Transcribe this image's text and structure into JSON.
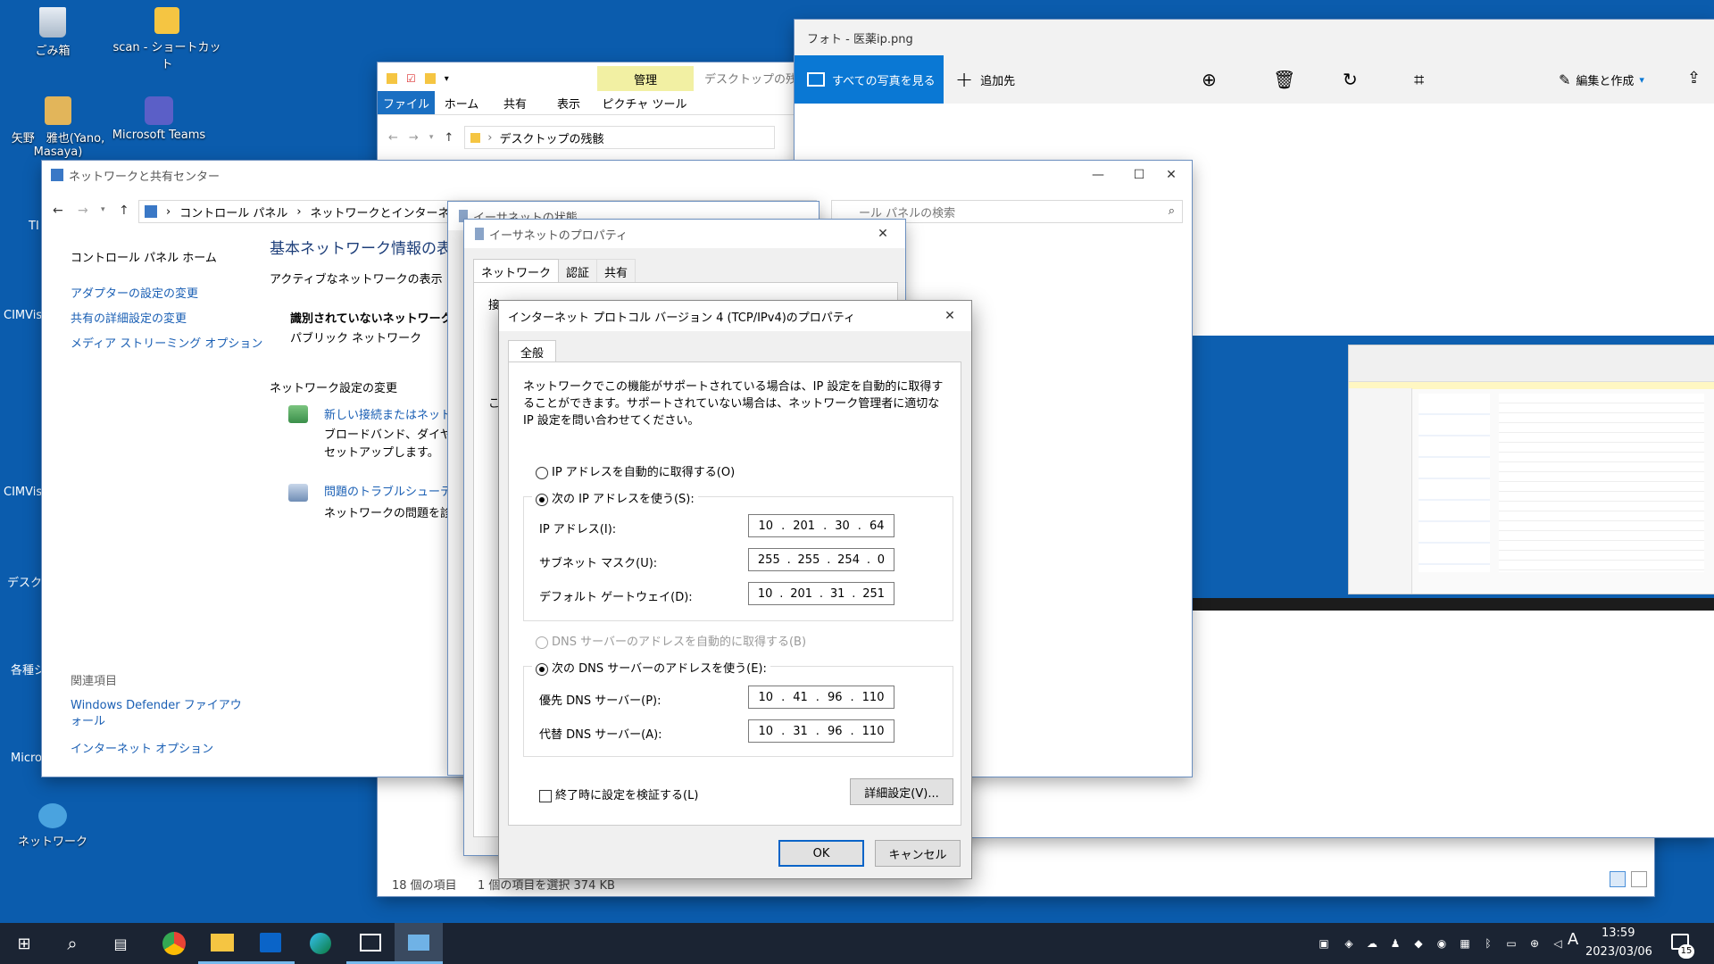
{
  "desktop": {
    "icons": [
      {
        "label": "ごみ箱"
      },
      {
        "label": "scan - ショートカット"
      },
      {
        "label": "矢野　雅也(Yano, Masaya)"
      },
      {
        "label": "Microsoft Teams"
      },
      {
        "label": "ネットワーク"
      }
    ],
    "partial_labels": [
      "TI",
      "CIMVis",
      "CIMVis",
      "デスクト",
      "各種シ",
      "Micro"
    ]
  },
  "explorer": {
    "ribbon_tabs": [
      "ファイル",
      "ホーム",
      "共有",
      "表示",
      "ピクチャ ツール"
    ],
    "manage_tab": "管理",
    "title": "デスクトップの残骸",
    "path": "デスクトップの残骸",
    "status_count": "18 個の項目",
    "status_selected": "1 個の項目を選択  374 KB"
  },
  "photos": {
    "title": "フォト - 医薬ip.png",
    "all_photos": "すべての写真を見る",
    "add_to": "追加先",
    "edit_create": "編集と作成"
  },
  "network_center": {
    "title": "ネットワークと共有センター",
    "breadcrumb": [
      "コントロール パネル",
      "ネットワークとインターネット"
    ],
    "search_placeholder": "ール パネルの検索",
    "side_home": "コントロール パネル ホーム",
    "side_links": [
      "アダプターの設定の変更",
      "共有の詳細設定の変更",
      "メディア ストリーミング オプション"
    ],
    "related_heading": "関連項目",
    "related_links": [
      "Windows Defender ファイアウォール",
      "インターネット オプション"
    ],
    "main_heading": "基本ネットワーク情報の表示と",
    "active_networks": "アクティブなネットワークの表示",
    "network_name": "識別されていないネットワーク",
    "network_type": "パブリック ネットワーク",
    "change_settings": "ネットワーク設定の変更",
    "new_connection_link": "新しい接続またはネットワ",
    "new_connection_desc": "ブロードバンド、ダイヤルア\nセットアップします。",
    "troubleshoot_link": "問題のトラブルシューティン",
    "troubleshoot_desc": "ネットワークの問題を診断"
  },
  "ethernet_status": {
    "title": "イーサネットの状態"
  },
  "ethernet_props": {
    "title": "イーサネットのプロパティ",
    "tabs": [
      "ネットワーク",
      "認証",
      "共有"
    ],
    "partial_connect": "接",
    "partial_this": "こ"
  },
  "ipv4": {
    "title": "インターネット プロトコル バージョン 4 (TCP/IPv4)のプロパティ",
    "tab": "全般",
    "description": "ネットワークでこの機能がサポートされている場合は、IP 設定を自動的に取得することができます。サポートされていない場合は、ネットワーク管理者に適切な IP 設定を問い合わせてください。",
    "auto_ip": "IP アドレスを自動的に取得する(O)",
    "manual_ip": "次の IP アドレスを使う(S):",
    "ip_label": "IP アドレス(I):",
    "ip": [
      "10",
      "201",
      "30",
      "64"
    ],
    "mask_label": "サブネット マスク(U):",
    "mask": [
      "255",
      "255",
      "254",
      "0"
    ],
    "gateway_label": "デフォルト ゲートウェイ(D):",
    "gateway": [
      "10",
      "201",
      "31",
      "251"
    ],
    "auto_dns": "DNS サーバーのアドレスを自動的に取得する(B)",
    "manual_dns": "次の DNS サーバーのアドレスを使う(E):",
    "dns1_label": "優先 DNS サーバー(P):",
    "dns1": [
      "10",
      "41",
      "96",
      "110"
    ],
    "dns2_label": "代替 DNS サーバー(A):",
    "dns2": [
      "10",
      "31",
      "96",
      "110"
    ],
    "validate": "終了時に設定を検証する(L)",
    "advanced": "詳細設定(V)...",
    "ok": "OK",
    "cancel": "キャンセル"
  },
  "taskbar": {
    "time": "13:59",
    "date": "2023/03/06",
    "ime": "A",
    "notifications": "15"
  }
}
